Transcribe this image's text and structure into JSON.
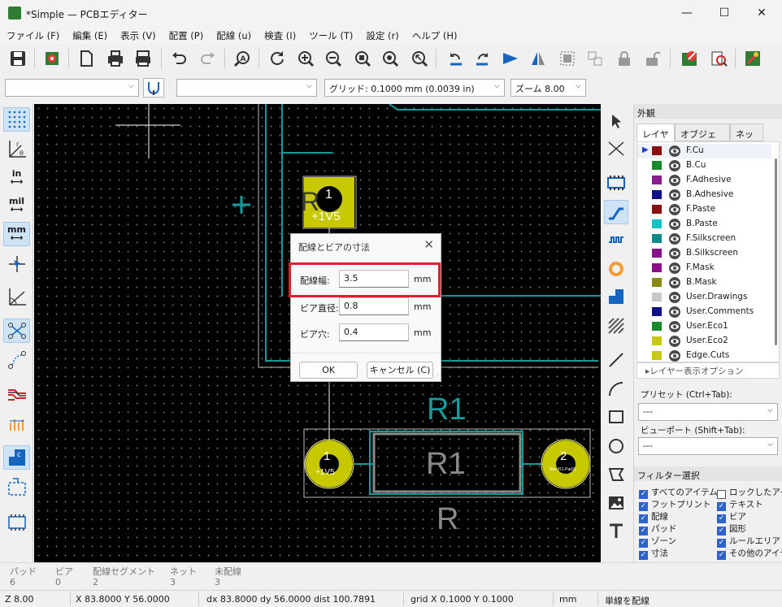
{
  "window": {
    "title": "*Simple — PCBエディター",
    "controls": {
      "minimize": "—",
      "maximize": "☐",
      "close": "✕"
    }
  },
  "menu": [
    "ファイル (F)",
    "編集 (E)",
    "表示 (V)",
    "配置 (P)",
    "配線 (u)",
    "検査 (I)",
    "ツール (T)",
    "設定 (r)",
    "ヘルプ (H)"
  ],
  "toolbar2": {
    "track_width": "",
    "via_size": "",
    "grid": "グリッド: 0.1000 mm (0.0039 in)",
    "zoom": "ズーム 8.00"
  },
  "left_toolbar": {
    "units_in": "in",
    "units_mil": "mil",
    "units_mm": "mm"
  },
  "canvas": {
    "pad_top_number": "1",
    "pad_top_net": "+1V5",
    "ref_label": "R1",
    "value_label": "R",
    "body_label": "R1",
    "pad1_number": "1",
    "pad1_net": "+1V5",
    "pad2_number": "2",
    "pad2_net": "Net-(R1-Pad2)"
  },
  "dialog": {
    "title": "配線とビアの寸法",
    "close": "✕",
    "fields": [
      {
        "label": "配線幅:",
        "value": "3.5",
        "unit": "mm"
      },
      {
        "label": "ビア直径:",
        "value": "0.8",
        "unit": "mm"
      },
      {
        "label": "ビア穴:",
        "value": "0.4",
        "unit": "mm"
      }
    ],
    "ok": "OK",
    "cancel": "キャンセル (C)"
  },
  "appearance": {
    "title": "外観",
    "tabs": [
      "レイヤー",
      "オブジェクト",
      "ネット"
    ],
    "layers": [
      {
        "name": "F.Cu",
        "color": "#8a0e0e",
        "current": true
      },
      {
        "name": "B.Cu",
        "color": "#1b8a2c"
      },
      {
        "name": "F.Adhesive",
        "color": "#8a1b8a"
      },
      {
        "name": "B.Adhesive",
        "color": "#0f0f8a"
      },
      {
        "name": "F.Paste",
        "color": "#8a0e0e"
      },
      {
        "name": "B.Paste",
        "color": "#12c4c4"
      },
      {
        "name": "F.Silkscreen",
        "color": "#0f8a8a"
      },
      {
        "name": "B.Silkscreen",
        "color": "#8a108a"
      },
      {
        "name": "F.Mask",
        "color": "#8a108a"
      },
      {
        "name": "B.Mask",
        "color": "#8a8a10"
      },
      {
        "name": "User.Drawings",
        "color": "#c8c8c8"
      },
      {
        "name": "User.Comments",
        "color": "#10108a"
      },
      {
        "name": "User.Eco1",
        "color": "#1b8a2c"
      },
      {
        "name": "User.Eco2",
        "color": "#c8c810"
      },
      {
        "name": "Edge.Cuts",
        "color": "#c8c810"
      }
    ],
    "layer_options": "▸レイヤー表示オプション",
    "preset_label": "プリセット (Ctrl+Tab):",
    "preset_value": "---",
    "viewport_label": "ビューポート (Shift+Tab):",
    "viewport_value": "---"
  },
  "filter": {
    "title": "フィルター選択",
    "items": [
      {
        "label": "すべてのアイテム",
        "checked": true
      },
      {
        "label": "ロックしたアイテ",
        "checked": false
      },
      {
        "label": "フットプリント",
        "checked": true
      },
      {
        "label": "テキスト",
        "checked": true
      },
      {
        "label": "配線",
        "checked": true
      },
      {
        "label": "ビア",
        "checked": true
      },
      {
        "label": "パッド",
        "checked": true
      },
      {
        "label": "図形",
        "checked": true
      },
      {
        "label": "ゾーン",
        "checked": true
      },
      {
        "label": "ルールエリア",
        "checked": true
      },
      {
        "label": "寸法",
        "checked": true
      },
      {
        "label": "その他のアイテ",
        "checked": true
      }
    ]
  },
  "messages": {
    "headers": [
      "パッド",
      "ビア",
      "配線セグメント",
      "ネット",
      "未配線"
    ],
    "values": [
      "6",
      "0",
      "2",
      "3",
      "3"
    ]
  },
  "status": {
    "zoom": "Z 8.00",
    "coords": "X 83.8000  Y 56.0000",
    "delta": "dx 83.8000  dy 56.0000  dist 100.7891",
    "grid": "grid X 0.1000  Y 0.1000",
    "units": "mm",
    "mode": "単線を配線"
  }
}
